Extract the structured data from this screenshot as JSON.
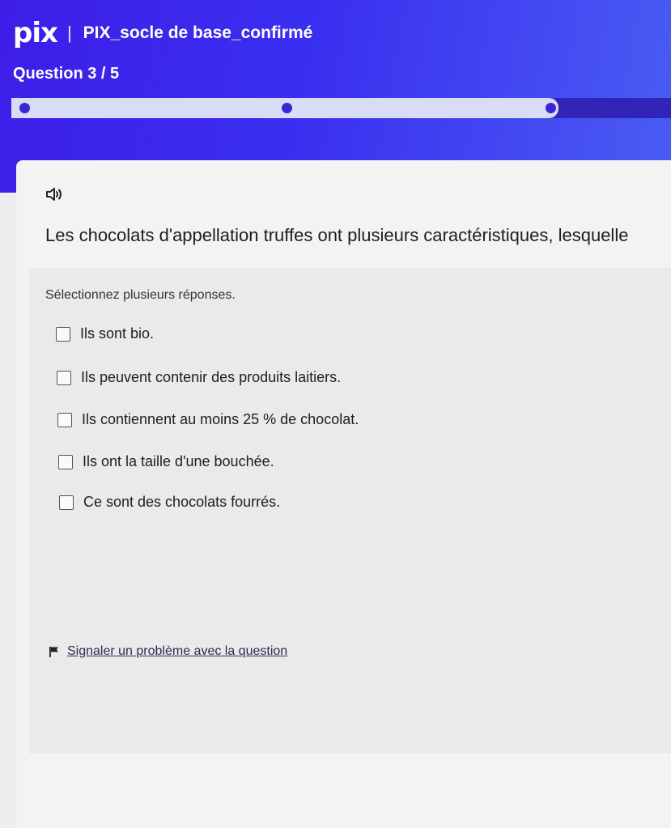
{
  "header": {
    "logo": "pix",
    "separator": "|",
    "campaign": "PIX_socle de base_confirmé",
    "question_counter": "Question 3 / 5",
    "progress": {
      "current": 3,
      "total": 5
    }
  },
  "question": {
    "audio_icon": "speaker-icon",
    "text": "Les chocolats d'appellation truffes ont plusieurs caractéristiques, lesquelle",
    "instruction": "Sélectionnez plusieurs réponses.",
    "options": [
      {
        "label": "Ils sont bio.",
        "checked": false
      },
      {
        "label": "Ils peuvent contenir des produits laitiers.",
        "checked": false
      },
      {
        "label": "Ils contiennent au moins 25 % de chocolat.",
        "checked": false
      },
      {
        "label": "Ils ont la taille d'une bouchée.",
        "checked": false
      },
      {
        "label": "Ce sont des chocolats fourrés.",
        "checked": false
      }
    ]
  },
  "report": {
    "icon": "flag-icon",
    "label": "Signaler un problème avec la question"
  },
  "colors": {
    "header_blue": "#3d1ee8",
    "progress_fill": "#d8dcf4",
    "progress_dot": "#3b26d6"
  }
}
